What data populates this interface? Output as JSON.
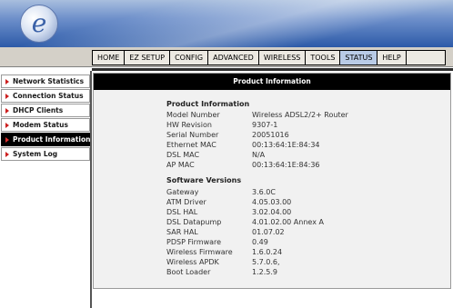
{
  "header": {
    "logo_letter": "e"
  },
  "nav": {
    "tabs": [
      {
        "label": "HOME",
        "name": "tab-home"
      },
      {
        "label": "EZ SETUP",
        "name": "tab-ez-setup"
      },
      {
        "label": "CONFIG",
        "name": "tab-config"
      },
      {
        "label": "ADVANCED",
        "name": "tab-advanced"
      },
      {
        "label": "WIRELESS",
        "name": "tab-wireless"
      },
      {
        "label": "TOOLS",
        "name": "tab-tools"
      },
      {
        "label": "STATUS",
        "name": "tab-status",
        "active": true
      },
      {
        "label": "HELP",
        "name": "tab-help"
      }
    ]
  },
  "sidebar": {
    "items": [
      {
        "label": "Network Statistics",
        "name": "sidebar-item-network-statistics"
      },
      {
        "label": "Connection Status",
        "name": "sidebar-item-connection-status"
      },
      {
        "label": "DHCP Clients",
        "name": "sidebar-item-dhcp-clients"
      },
      {
        "label": "Modem Status",
        "name": "sidebar-item-modem-status"
      },
      {
        "label": "Product Information",
        "name": "sidebar-item-product-information",
        "active": true
      },
      {
        "label": "System Log",
        "name": "sidebar-item-system-log"
      }
    ]
  },
  "panel": {
    "title": "Product Information",
    "product": {
      "heading": "Product Information",
      "rows": [
        {
          "label": "Model Number",
          "value": "Wireless ADSL2/2+ Router"
        },
        {
          "label": "HW Revision",
          "value": "9307-1"
        },
        {
          "label": "Serial Number",
          "value": "20051016"
        },
        {
          "label": "Ethernet MAC",
          "value": "00:13:64:1E:84:34"
        },
        {
          "label": "DSL MAC",
          "value": "N/A"
        },
        {
          "label": "AP MAC",
          "value": "00:13:64:1E:84:36"
        }
      ]
    },
    "software": {
      "heading": "Software Versions",
      "rows": [
        {
          "label": "Gateway",
          "value": "3.6.0C"
        },
        {
          "label": "ATM Driver",
          "value": "4.05.03.00"
        },
        {
          "label": "DSL HAL",
          "value": "3.02.04.00"
        },
        {
          "label": "DSL Datapump",
          "value": "4.01.02.00 Annex A"
        },
        {
          "label": "SAR HAL",
          "value": "01.07.02"
        },
        {
          "label": "PDSP Firmware",
          "value": "0.49"
        },
        {
          "label": "Wireless Firmware",
          "value": "1.6.0.24"
        },
        {
          "label": "Wireless APDK",
          "value": "5.7.0.6,"
        },
        {
          "label": "Boot Loader",
          "value": "1.2.5.9"
        }
      ]
    }
  },
  "colors": {
    "accent_active_tab": "#b9cbe6",
    "sidebar_arrow": "#cc1f1f",
    "panel_header": "#000000"
  }
}
